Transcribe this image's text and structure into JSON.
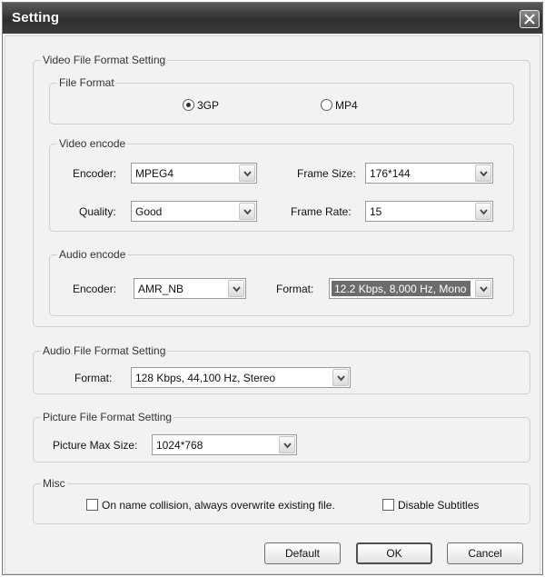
{
  "window": {
    "title": "Setting"
  },
  "video_file": {
    "legend": "Video File Format Setting",
    "file_format": {
      "legend": "File Format",
      "options": [
        "3GP",
        "MP4"
      ],
      "selected": "3GP"
    },
    "video_encode": {
      "legend": "Video encode",
      "encoder_label": "Encoder:",
      "encoder_value": "MPEG4",
      "frame_size_label": "Frame Size:",
      "frame_size_value": "176*144",
      "quality_label": "Quality:",
      "quality_value": "Good",
      "frame_rate_label": "Frame Rate:",
      "frame_rate_value": "15"
    },
    "audio_encode": {
      "legend": "Audio encode",
      "encoder_label": "Encoder:",
      "encoder_value": "AMR_NB",
      "format_label": "Format:",
      "format_value": "12.2 Kbps, 8,000 Hz, Mono"
    }
  },
  "audio_file": {
    "legend": "Audio File Format Setting",
    "format_label": "Format:",
    "format_value": "128 Kbps, 44,100 Hz, Stereo"
  },
  "picture_file": {
    "legend": "Picture File Format Setting",
    "max_size_label": "Picture Max Size:",
    "max_size_value": "1024*768"
  },
  "misc": {
    "legend": "Misc",
    "overwrite_label": "On name collision, always overwrite existing file.",
    "overwrite_checked": false,
    "disable_subtitles_label": "Disable Subtitles",
    "disable_subtitles_checked": false
  },
  "buttons": {
    "default_label": "Default",
    "ok_label": "OK",
    "cancel_label": "Cancel"
  },
  "icons": {
    "close": "close-icon",
    "dropdown": "chevron-down-icon"
  }
}
